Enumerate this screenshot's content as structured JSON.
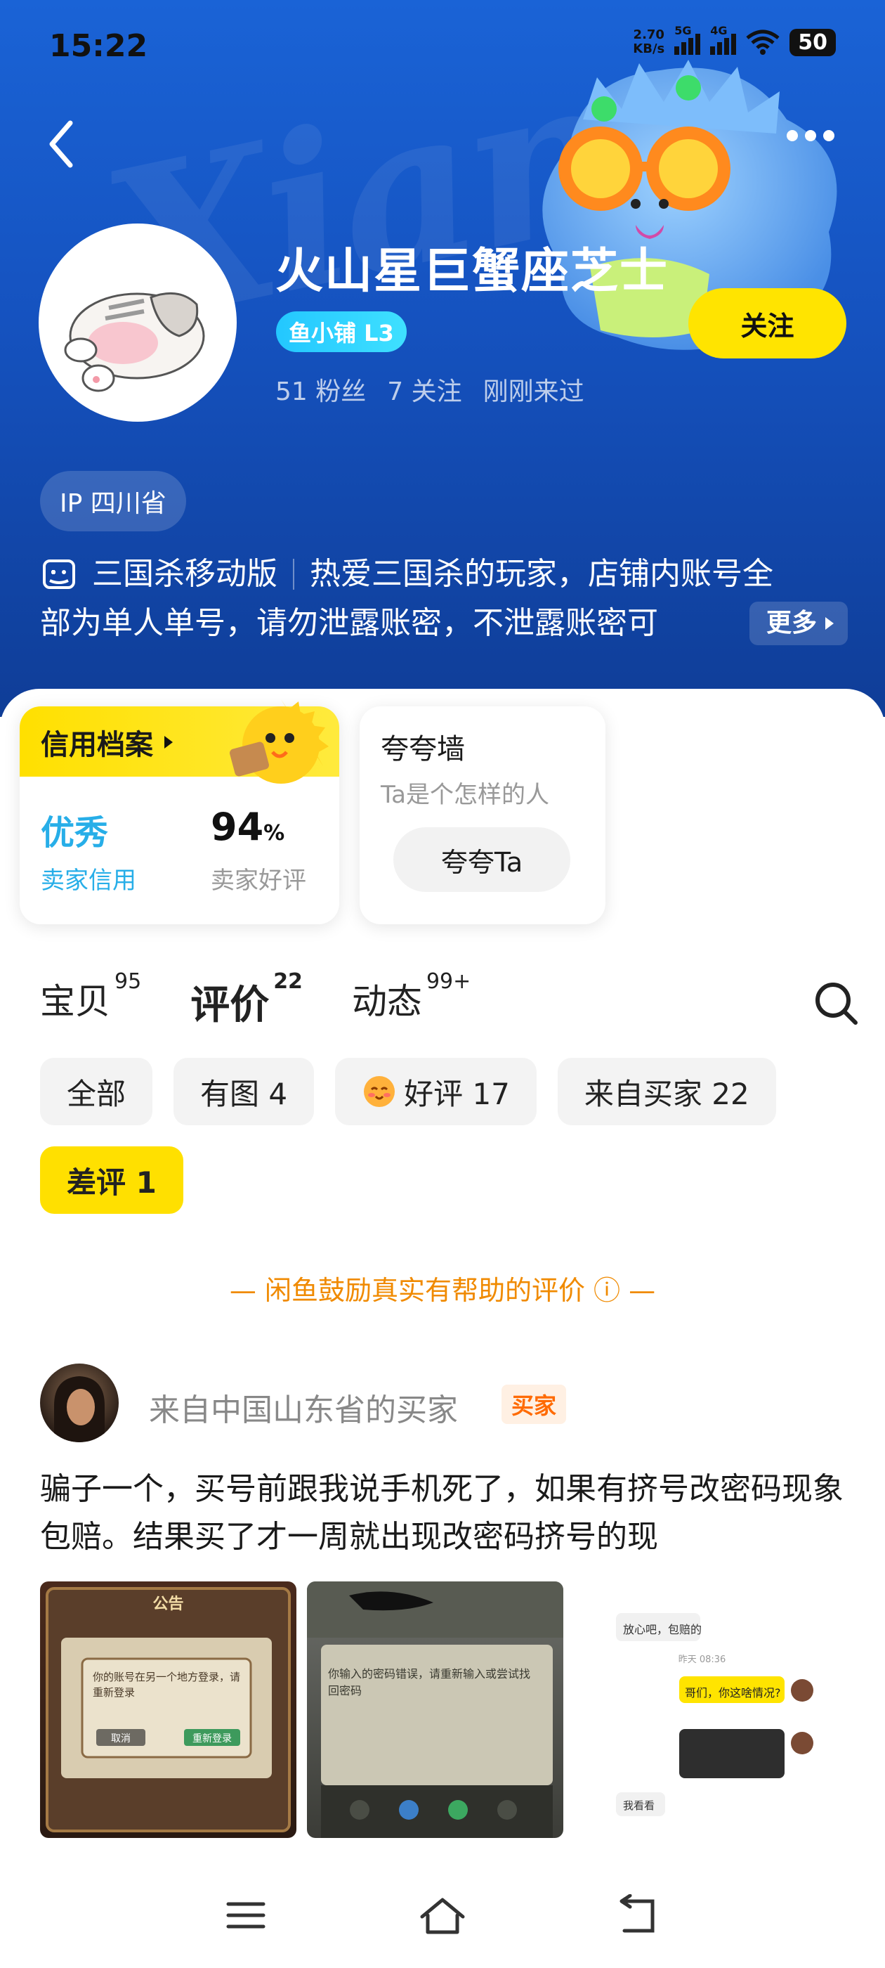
{
  "status_bar": {
    "time": "15:22",
    "net_speed": "2.70",
    "net_unit": "KB/s",
    "sim1": "5G",
    "sim2": "4G",
    "battery": "50"
  },
  "header": {
    "shop_name": "火山星巨蟹座芝士",
    "level_badge": "鱼小铺 L3",
    "follow_label": "关注",
    "fans": "51 粉丝",
    "following": "7 关注",
    "last_seen": "刚刚来过",
    "ip_location": "IP 四川省",
    "desc_category": "三国杀移动版",
    "desc_line1": "热爱三国杀的玩家，店铺内账号全",
    "desc_line2": "部为单人单号，请勿泄露账密，不泄露账密可",
    "more_label": "更多"
  },
  "credit": {
    "title": "信用档案",
    "rating": "优秀",
    "rating_label": "卖家信用",
    "good_rate": "94",
    "good_rate_unit": "%",
    "good_rate_label": "卖家好评"
  },
  "praise": {
    "title": "夸夸墙",
    "subtitle": "Ta是个怎样的人",
    "button": "夸夸Ta"
  },
  "tabs": [
    {
      "label": "宝贝",
      "count": "95"
    },
    {
      "label": "评价",
      "count": "22",
      "active": true
    },
    {
      "label": "动态",
      "count": "99+"
    }
  ],
  "filters": [
    {
      "label": "全部"
    },
    {
      "label": "有图 4"
    },
    {
      "label": "好评 17",
      "icon": "smile-emoji-icon"
    },
    {
      "label": "来自买家 22"
    },
    {
      "label": "差评 1",
      "active": true
    }
  ],
  "notice": "— 闲鱼鼓励真实有帮助的评价 ⓘ —",
  "review": {
    "reviewer": "来自中国山东省的买家",
    "tag": "买家",
    "text": "骗子一个，买号前跟我说手机死了，如果有挤号改密码现象包赔。结果买了才一周就出现改密码挤号的现",
    "photos": [
      "game-notice-screenshot",
      "password-error-screenshot",
      "chat-screenshot"
    ],
    "photo_texts": {
      "p1_title": "公告",
      "p1_msg": "你的账号在另一个地方登录，请重新登录",
      "p1_cancel": "取消",
      "p1_ok": "重新登录",
      "p2_msg": "你输入的密码错误，请重新输入或尝试找回密码",
      "chat_1": "放心吧，包赔的",
      "chat_time": "昨天 08:36",
      "chat_2": "哥们，你这啥情况?",
      "chat_3": "我看看"
    }
  },
  "colors": {
    "brand_yellow": "#ffe000",
    "header_blue": "#1552bf",
    "credit_blue": "#27aee8",
    "notice_orange": "#f08a00",
    "tag_orange": "#ff6a00"
  }
}
